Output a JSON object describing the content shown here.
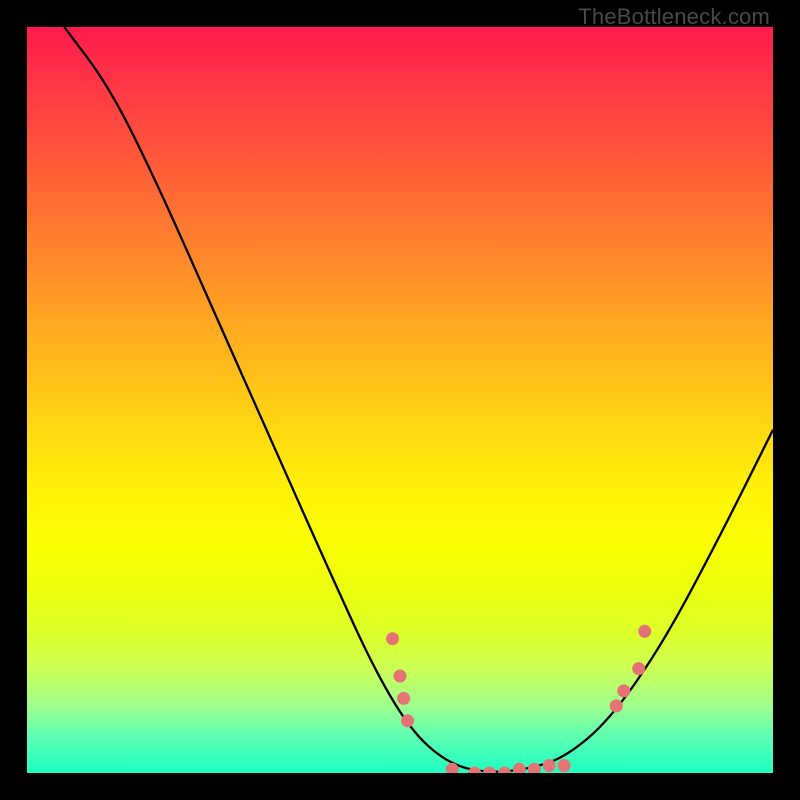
{
  "watermark": "TheBottleneck.com",
  "colors": {
    "background": "#000000",
    "curve_stroke": "#000000",
    "dot_fill": "#e57373",
    "gradient_top": "#ff1a4d",
    "gradient_bottom": "#1effc4"
  },
  "chart_data": {
    "type": "line",
    "title": "",
    "xlabel": "",
    "ylabel": "",
    "xlim": [
      0,
      100
    ],
    "ylim": [
      0,
      100
    ],
    "grid": false,
    "legend": false,
    "series": [
      {
        "name": "bottleneck-curve",
        "points": [
          {
            "x": 5,
            "y": 100
          },
          {
            "x": 11,
            "y": 92
          },
          {
            "x": 17,
            "y": 80
          },
          {
            "x": 25,
            "y": 62
          },
          {
            "x": 33,
            "y": 44
          },
          {
            "x": 41,
            "y": 26
          },
          {
            "x": 47,
            "y": 13
          },
          {
            "x": 52,
            "y": 5
          },
          {
            "x": 57,
            "y": 1
          },
          {
            "x": 62,
            "y": 0
          },
          {
            "x": 67,
            "y": 0.5
          },
          {
            "x": 72,
            "y": 2
          },
          {
            "x": 78,
            "y": 7
          },
          {
            "x": 85,
            "y": 17
          },
          {
            "x": 92,
            "y": 30
          },
          {
            "x": 100,
            "y": 46
          }
        ]
      }
    ],
    "data_points": [
      {
        "x": 49,
        "y": 18
      },
      {
        "x": 50,
        "y": 13
      },
      {
        "x": 50.5,
        "y": 10
      },
      {
        "x": 51,
        "y": 7
      },
      {
        "x": 57,
        "y": 0.5
      },
      {
        "x": 60,
        "y": 0
      },
      {
        "x": 62,
        "y": 0
      },
      {
        "x": 64,
        "y": 0
      },
      {
        "x": 66,
        "y": 0.5
      },
      {
        "x": 68,
        "y": 0.5
      },
      {
        "x": 70,
        "y": 1
      },
      {
        "x": 72,
        "y": 1
      },
      {
        "x": 79,
        "y": 9
      },
      {
        "x": 80,
        "y": 11
      },
      {
        "x": 82,
        "y": 14
      },
      {
        "x": 82.8,
        "y": 19
      }
    ]
  }
}
